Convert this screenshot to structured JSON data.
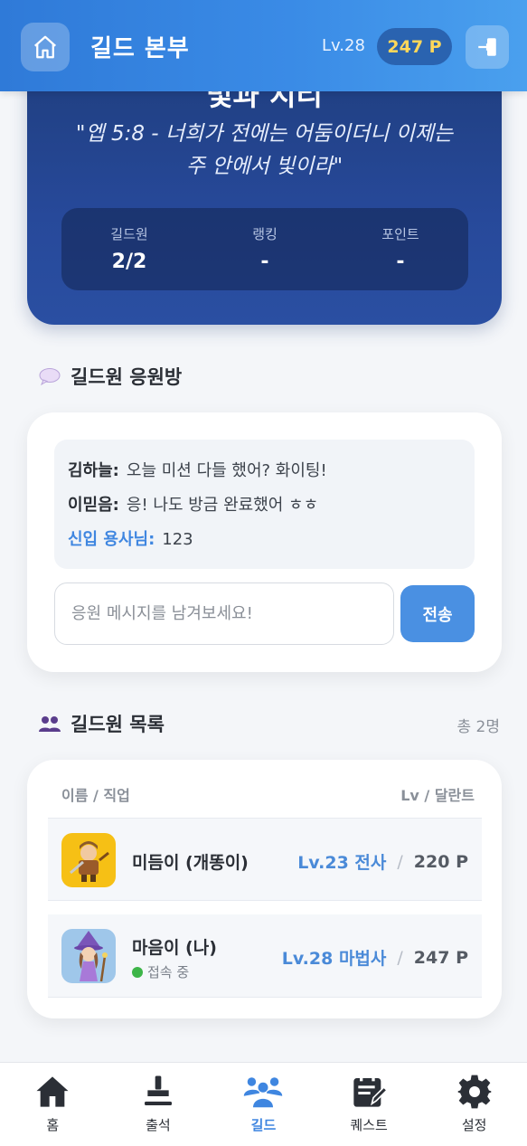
{
  "header": {
    "title": "길드 본부",
    "level": "Lv.28",
    "points": "247 P"
  },
  "hero": {
    "name": "빛과 지리",
    "verse": "\"엡 5:8 - 너희가 전에는 어둠이더니 이제는 주 안에서 빛이라\"",
    "stats": [
      {
        "label": "길드원",
        "value": "2/2"
      },
      {
        "label": "랭킹",
        "value": "-"
      },
      {
        "label": "포인트",
        "value": "-"
      }
    ]
  },
  "chat": {
    "title": "길드원 응원방",
    "messages": [
      {
        "name": "김하늘:",
        "text": "오늘 미션 다들 했어? 화이팅!"
      },
      {
        "name": "이믿음:",
        "text": "응! 나도 방금 완료했어 ㅎㅎ"
      },
      {
        "name": "신입 용사님:",
        "text": "123"
      }
    ],
    "input_placeholder": "응원 메시지를 남겨보세요!",
    "send_label": "전송"
  },
  "members": {
    "title": "길드원 목록",
    "count": "총 2명",
    "header_left": "이름 / 직업",
    "header_right": "Lv / 달란트",
    "rows": [
      {
        "name": "미듬이 (개똥이)",
        "level_class": "Lv.23 전사",
        "points": "220 P",
        "status": "",
        "avatar": "warrior-avatar"
      },
      {
        "name": "마음이 (나)",
        "level_class": "Lv.28 마법사",
        "points": "247 P",
        "status": "접속 중",
        "avatar": "mage-avatar"
      }
    ]
  },
  "nav": [
    {
      "label": "홈",
      "icon": "home-icon"
    },
    {
      "label": "출석",
      "icon": "stamp-icon"
    },
    {
      "label": "길드",
      "icon": "group-icon"
    },
    {
      "label": "퀘스트",
      "icon": "quest-icon"
    },
    {
      "label": "설정",
      "icon": "gear-icon"
    }
  ],
  "colors": {
    "header": "#3a8be6",
    "hero": "#27499a",
    "accent": "#4a90e2",
    "points": "#ffd75a",
    "online": "#3db548"
  }
}
